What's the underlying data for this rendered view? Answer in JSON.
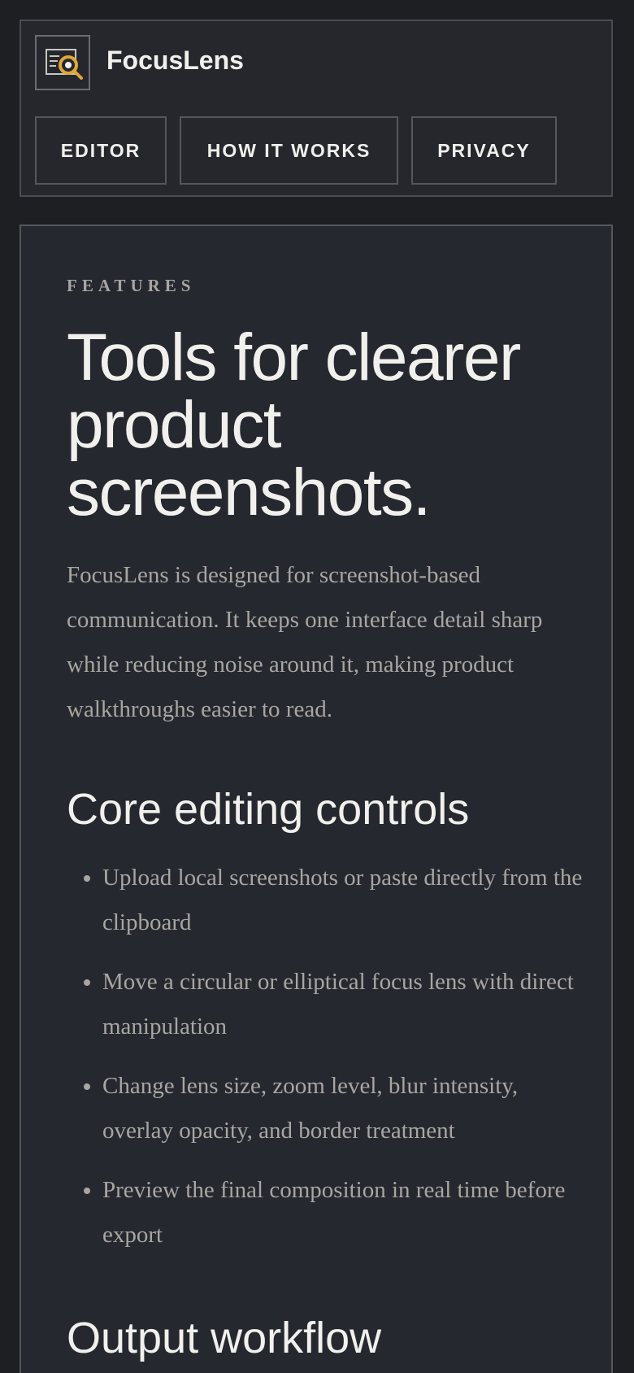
{
  "header": {
    "brand": "FocusLens",
    "logo_icon": "magnifier-document-icon",
    "nav": [
      {
        "label": "EDITOR"
      },
      {
        "label": "HOW IT WORKS"
      },
      {
        "label": "PRIVACY"
      }
    ]
  },
  "main": {
    "eyebrow": "FEATURES",
    "title": "Tools for clearer product screenshots.",
    "intro": "FocusLens is designed for screenshot-based communication. It keeps one interface detail sharp while reducing noise around it, making product walkthroughs easier to read.",
    "core_heading": "Core editing controls",
    "core_items": [
      "Upload local screenshots or paste directly from the clipboard",
      "Move a circular or elliptical focus lens with direct manipulation",
      "Change lens size, zoom level, blur intensity, overlay opacity, and border treatment",
      "Preview the final composition in real time before export"
    ],
    "output_heading": "Output workflow"
  },
  "colors": {
    "background": "#1d1f23",
    "panel": "#25272d",
    "text": "#f2f0ec",
    "muted_text": "#a9a6a0",
    "accent": "#e0a63a"
  }
}
